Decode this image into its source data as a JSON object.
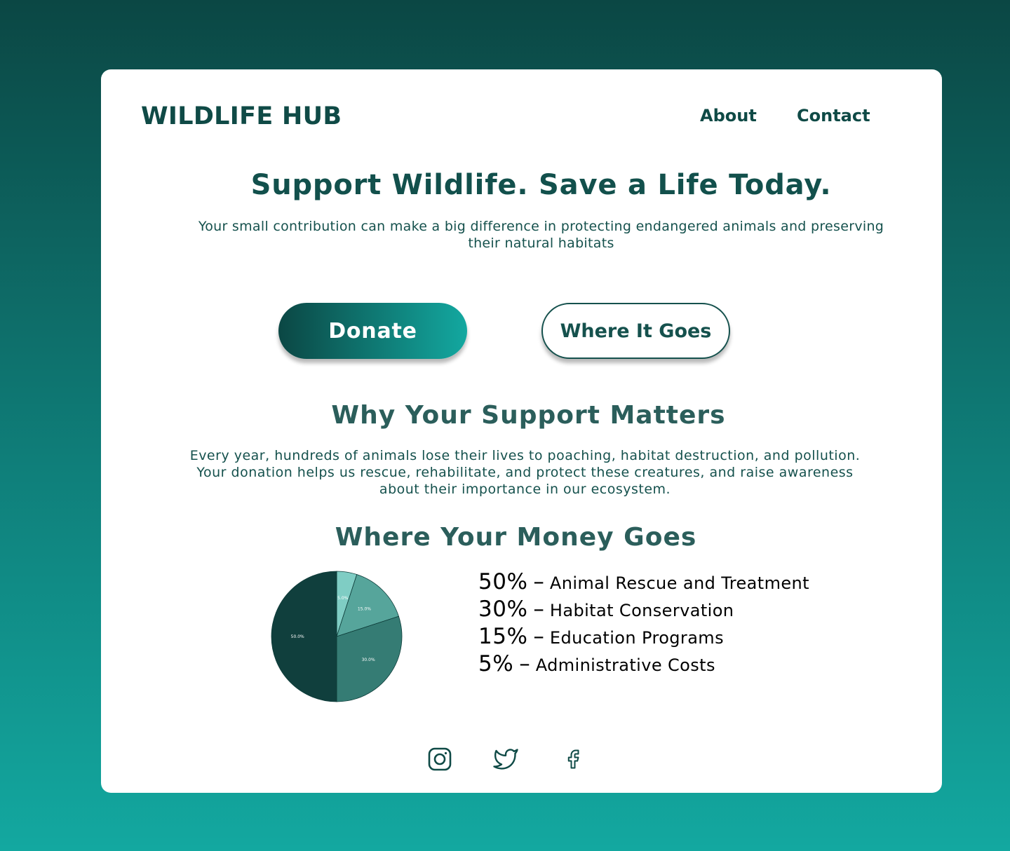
{
  "header": {
    "logo": "WILDLIFE HUB",
    "nav": [
      "About",
      "Contact"
    ]
  },
  "hero": {
    "title": "Support Wildlife. Save a Life Today.",
    "subtitle": "Your small contribution can make a big difference in protecting endangered animals and preserving their natural habitats"
  },
  "buttons": {
    "donate": "Donate",
    "where": "Where It Goes"
  },
  "why": {
    "title": "Why Your Support Matters",
    "text": "Every year, hundreds of animals lose their lives to poaching, habitat destruction, and pollution. Your donation helps us rescue, rehabilitate, and protect these creatures, and raise awareness about their importance in our ecosystem."
  },
  "money": {
    "title": "Where Your Money Goes",
    "legend": [
      {
        "pct": "50%",
        "dash": "–",
        "label": "Animal Rescue and Treatment"
      },
      {
        "pct": "30%",
        "dash": "–",
        "label": "Habitat Conservation"
      },
      {
        "pct": "15%",
        "dash": "–",
        "label": "Education Programs"
      },
      {
        "pct": "5%",
        "dash": "–",
        "label": "Administrative Costs"
      }
    ]
  },
  "chart_data": {
    "type": "pie",
    "categories": [
      "",
      "",
      "",
      ""
    ],
    "values": [
      5,
      15,
      30,
      50
    ],
    "slice_labels": [
      "5.0%",
      "15.0%",
      "30.0%",
      "50.0%"
    ],
    "colors": [
      "#7fcdc4",
      "#56a59b",
      "#357c74",
      "#103f3d"
    ],
    "title": "",
    "start": "top, clockwise"
  },
  "social": [
    "instagram-icon",
    "twitter-icon",
    "facebook-icon"
  ],
  "colors": {
    "primary": "#0f4a46",
    "gradient_start": "#0b4744",
    "gradient_end": "#13a8a0"
  }
}
